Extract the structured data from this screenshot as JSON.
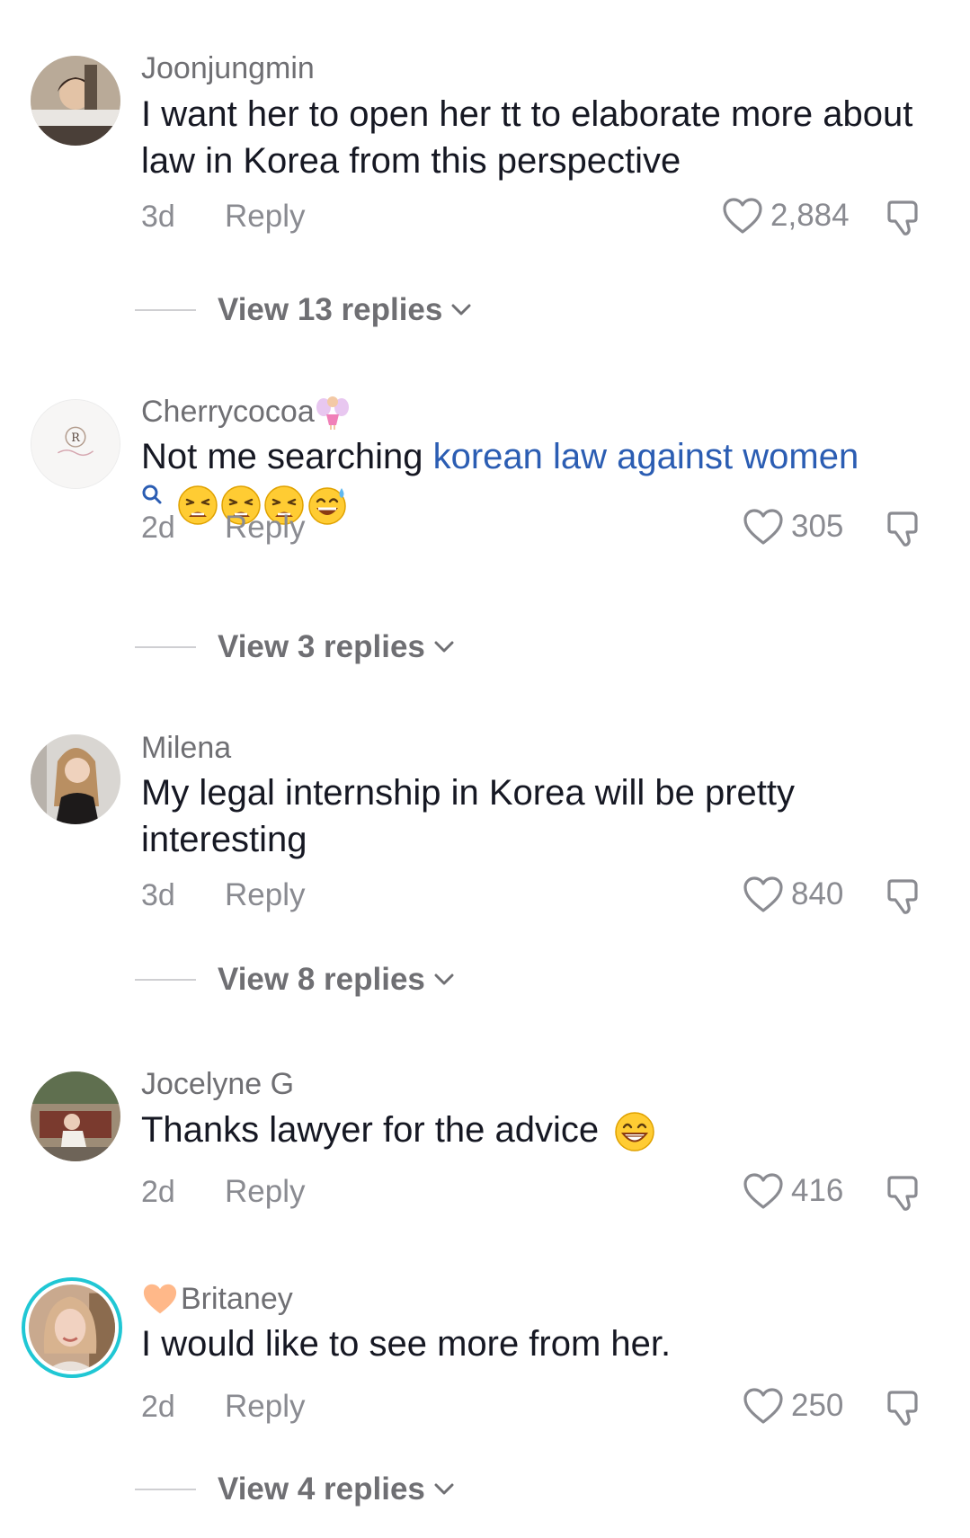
{
  "comments": [
    {
      "username": "Joonjungmin",
      "text": "I want her to open her tt to elaborate more about law in Korea from this perspective",
      "time": "3d",
      "reply_label": "Reply",
      "likes": "2,884",
      "view_replies": "View 13 replies"
    },
    {
      "username": "Cherrycocoa",
      "username_emoji": "fairy",
      "text_prefix": "Not me searching ",
      "link_text": "korean law against women",
      "trailing_emoji": [
        "weary",
        "weary",
        "weary",
        "sweat-smile"
      ],
      "time": "2d",
      "reply_label": "Reply",
      "likes": "305",
      "view_replies": "View 3 replies"
    },
    {
      "username": "Milena",
      "text": "My legal internship in Korea will be pretty interesting",
      "time": "3d",
      "reply_label": "Reply",
      "likes": "840",
      "view_replies": "View 8 replies"
    },
    {
      "username": "Jocelyne G",
      "text": "Thanks lawyer for the advice",
      "trailing_emoji": [
        "grin"
      ],
      "time": "2d",
      "reply_label": "Reply",
      "likes": "416"
    },
    {
      "username": "Britaney",
      "username_emoji": "orange-heart",
      "text": "I would like to see more from her.",
      "time": "2d",
      "reply_label": "Reply",
      "likes": "250",
      "view_replies": "View 4 replies"
    }
  ],
  "icons": {
    "like": "heart-outline-icon",
    "dislike": "thumbs-down-icon",
    "expand": "chevron-down-icon",
    "search": "search-icon"
  },
  "colors": {
    "link": "#2b5db3",
    "meta": "#8a8b91",
    "username": "#6f6f73",
    "story_ring": "#20c7d4"
  }
}
